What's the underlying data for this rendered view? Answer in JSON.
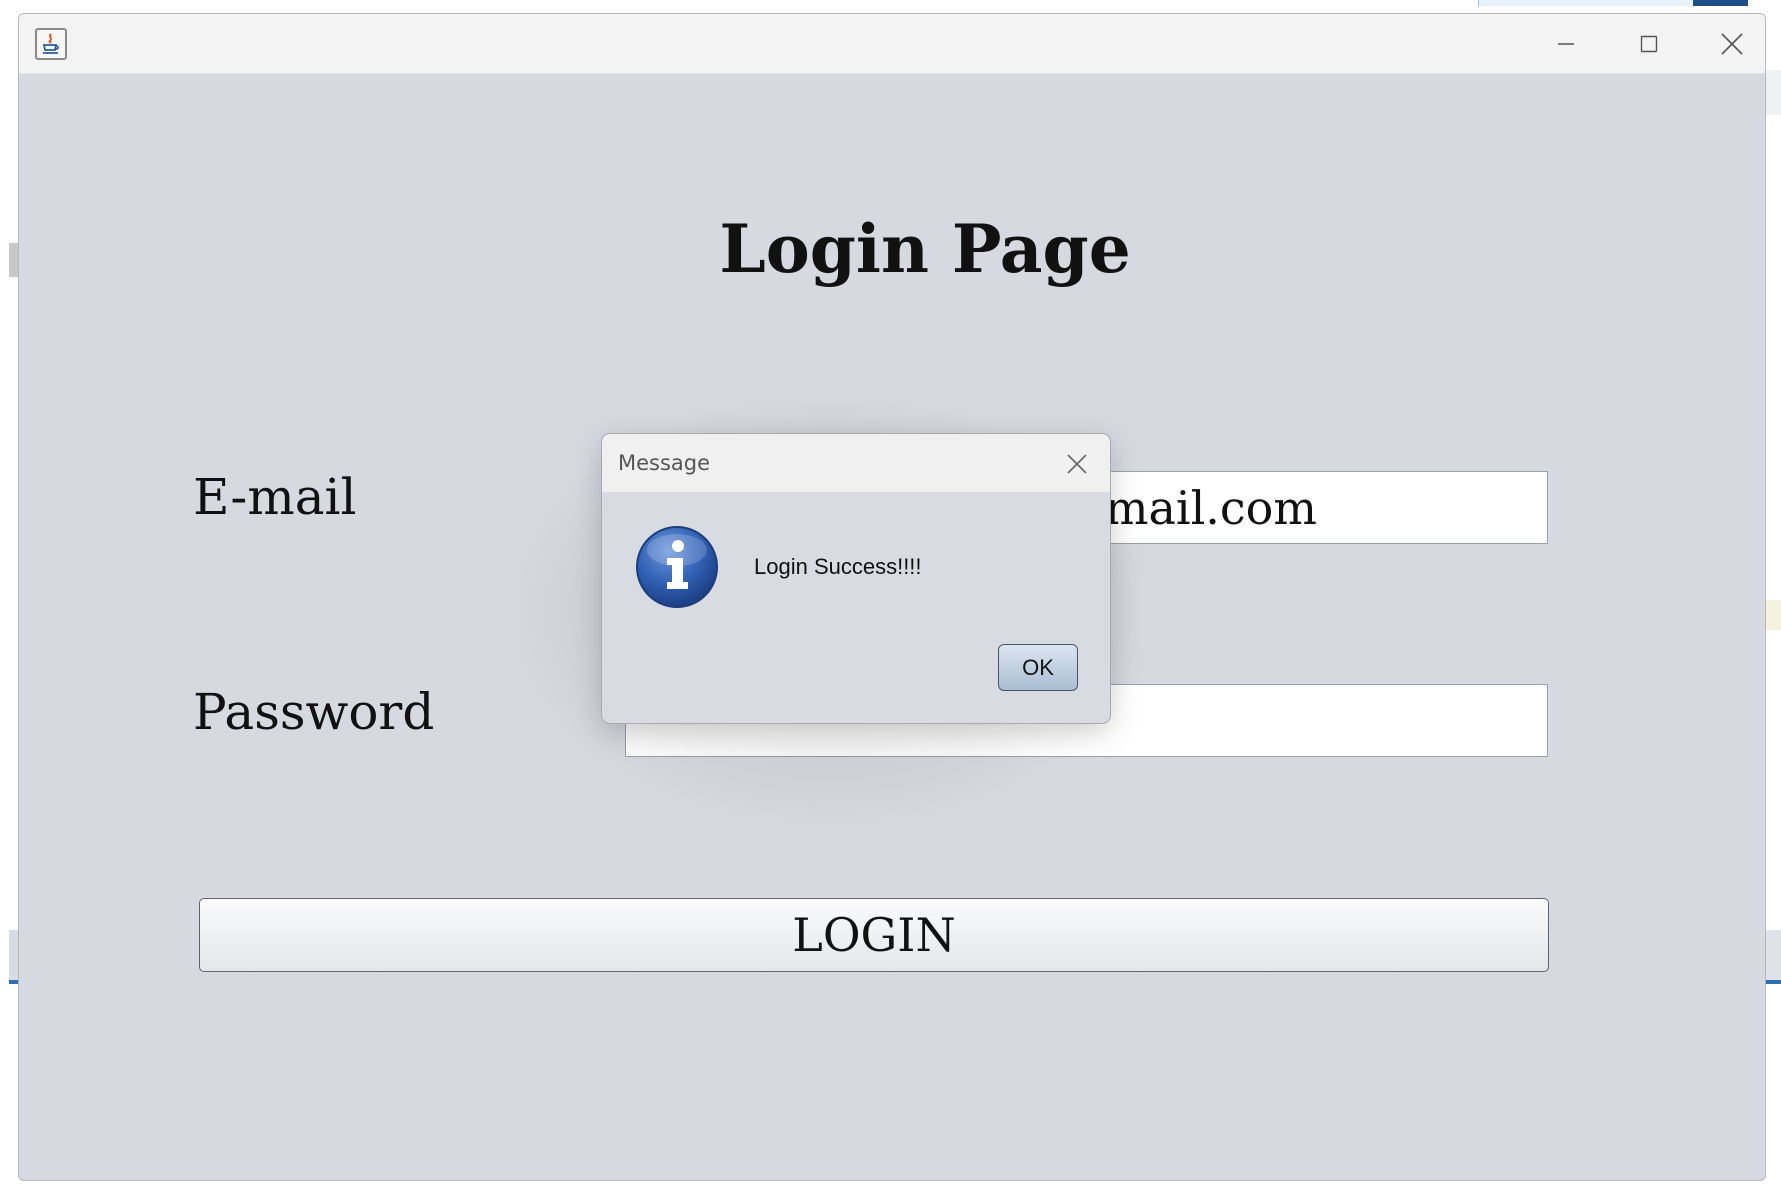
{
  "window": {
    "title": ""
  },
  "page": {
    "title": "Login Page",
    "email_label": "E-mail",
    "email_value": "gmail.com",
    "password_label": "Password",
    "password_mask": "*******",
    "login_button_label": "LOGIN"
  },
  "dialog": {
    "title": "Message",
    "message": "Login Success!!!!",
    "ok_label": "OK",
    "icon": "info-icon"
  },
  "icons": {
    "app": "java-icon",
    "minimize": "minimize-icon",
    "maximize": "maximize-icon",
    "close": "close-icon"
  },
  "colors": {
    "window_background": "#d6d9e0",
    "titlebar": "#f3f3f3",
    "info_icon": "#2f5fb3"
  }
}
